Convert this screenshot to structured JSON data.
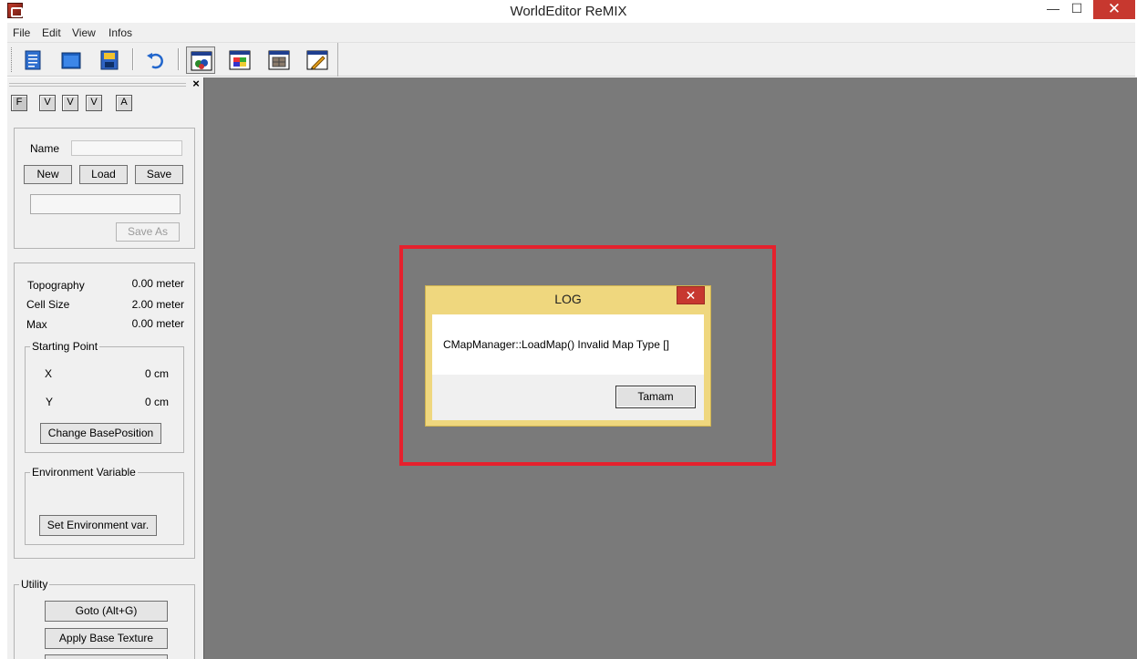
{
  "window": {
    "title": "WorldEditor ReMIX",
    "minimize_glyph": "—",
    "maximize_glyph": "☐",
    "close_glyph": "✕"
  },
  "menu": [
    "File",
    "Edit",
    "View",
    "Infos"
  ],
  "toolbar": {
    "icons": [
      "new-document-icon",
      "open-folder-icon",
      "save-icon",
      "undo-icon",
      "object-view-icon",
      "texture-view-icon",
      "grid-view-icon",
      "brush-tool-icon"
    ]
  },
  "left_panel": {
    "close_glyph": "×",
    "tabs": [
      "F",
      "V",
      "V",
      "V",
      "A"
    ],
    "map": {
      "name_label": "Name",
      "name_value": "",
      "new_label": "New",
      "load_label": "Load",
      "save_label": "Save",
      "path_value": "",
      "save_as_label": "Save As"
    },
    "info": {
      "topography_label": "Topography",
      "topography_value": "0.00 meter",
      "cell_size_label": "Cell Size",
      "cell_size_value": "2.00 meter",
      "max_label": "Max",
      "max_value": "0.00 meter"
    },
    "starting_point": {
      "title": "Starting Point",
      "x_label": "X",
      "x_value": "0 cm",
      "y_label": "Y",
      "y_value": "0 cm",
      "change_label": "Change BasePosition"
    },
    "environment": {
      "title": "Environment Variable",
      "set_label": "Set Environment var."
    },
    "utility": {
      "title": "Utility",
      "goto_label": "Goto (Alt+G)",
      "apply_texture_label": "Apply Base Texture"
    }
  },
  "dialog": {
    "title": "LOG",
    "close_glyph": "✕",
    "message": "CMapManager::LoadMap() Invalid Map Type []",
    "ok_label": "Tamam"
  },
  "colors": {
    "highlight": "#e5212d",
    "dialog_frame": "#efd77e",
    "close_red": "#c7382f",
    "workspace": "#7a7a7a"
  }
}
